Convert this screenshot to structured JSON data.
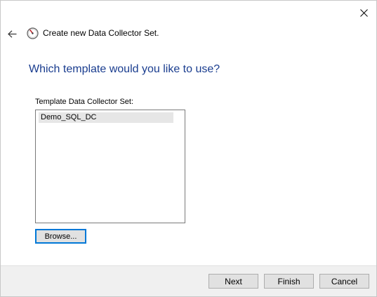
{
  "window": {
    "title": "Create new Data Collector Set."
  },
  "page": {
    "heading": "Which template would you like to use?"
  },
  "template_list": {
    "label": "Template Data Collector Set:",
    "items": [
      {
        "label": "Demo_SQL_DC",
        "selected": true
      }
    ]
  },
  "buttons": {
    "browse": "Browse...",
    "next": "Next",
    "finish": "Finish",
    "cancel": "Cancel"
  },
  "icons": {
    "close": "close-icon",
    "back": "back-arrow-icon",
    "app": "performance-monitor-icon"
  },
  "colors": {
    "heading": "#1a3d8f",
    "focus_border": "#0078d7",
    "selection": "#e6e6e6",
    "footer": "#f0f0f0"
  }
}
